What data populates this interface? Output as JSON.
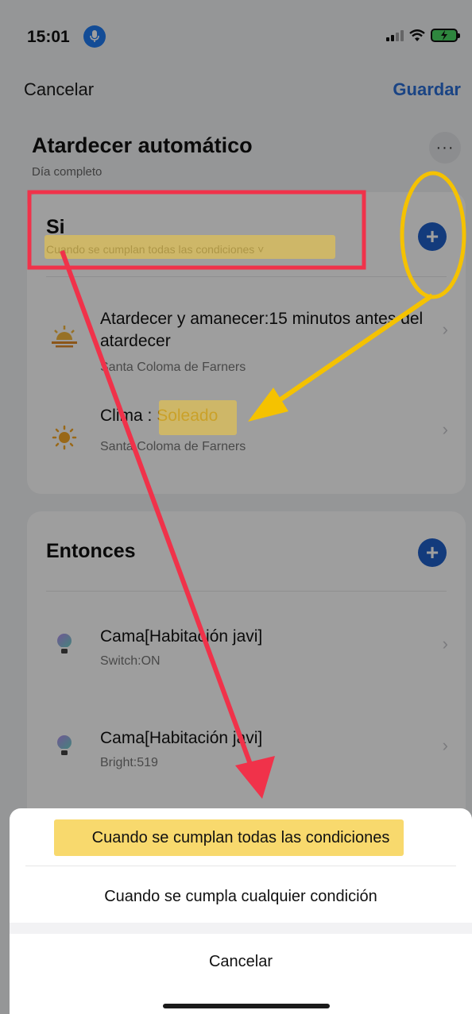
{
  "status": {
    "time": "15:01"
  },
  "nav": {
    "cancel": "Cancelar",
    "save": "Guardar"
  },
  "scene": {
    "title": "Atardecer automático",
    "subtitle": "Día completo",
    "more": "···"
  },
  "if_section": {
    "title": "Si",
    "condition_mode": "Cuando se cumplan todas las condiciones ˅",
    "conditions": [
      {
        "title": "Atardecer y amanecer:15 minutos antes del atardecer",
        "subtitle": "Santa Coloma de Farners",
        "icon": "sunset-icon"
      },
      {
        "title_prefix": "Clima : ",
        "title_value": "Soleado",
        "subtitle": "Santa Coloma de Farners",
        "icon": "sun-icon"
      }
    ]
  },
  "then_section": {
    "title": "Entonces",
    "actions": [
      {
        "title": "Cama[Habitación javi]",
        "subtitle": "Switch:ON",
        "icon": "lightbulb-icon"
      },
      {
        "title": "Cama[Habitación javi]",
        "subtitle": "Bright:519",
        "icon": "lightbulb-icon"
      }
    ]
  },
  "sheet": {
    "option_all": "Cuando se cumplan todas las condiciones",
    "option_any": "Cuando se cumpla cualquier condición",
    "cancel": "Cancelar"
  },
  "colors": {
    "accent_blue": "#1f5fc9",
    "annotation_red": "#f0324a",
    "annotation_yellow": "#f5c200",
    "highlight_yellow": "#f5cc3c"
  }
}
